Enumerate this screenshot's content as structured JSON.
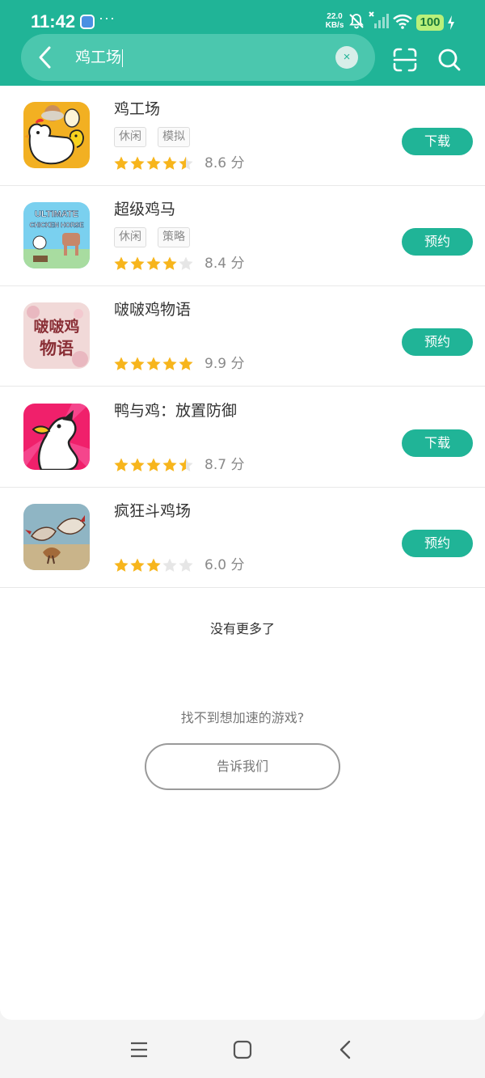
{
  "status_bar": {
    "time": "11:42",
    "dots": "···",
    "net_speed_value": "22.0",
    "net_speed_unit": "KB/s",
    "battery": "100"
  },
  "search": {
    "query": "鸡工场",
    "clear_label": "×"
  },
  "results": [
    {
      "title": "鸡工场",
      "tags": [
        "休闲",
        "模拟"
      ],
      "rating": 4.5,
      "score": "8.6 分",
      "action": "下载"
    },
    {
      "title": "超级鸡马",
      "tags": [
        "休闲",
        "策略"
      ],
      "rating": 4,
      "score": "8.4 分",
      "action": "预约",
      "icon_text": "ULTIMATE CHICKEN HORSE"
    },
    {
      "title": "啵啵鸡物语",
      "tags": [],
      "rating": 5,
      "score": "9.9 分",
      "action": "预约",
      "icon_text": "啵啵鸡 物语"
    },
    {
      "title": "鸭与鸡：放置防御",
      "tags": [],
      "rating": 4.5,
      "score": "8.7 分",
      "action": "下载"
    },
    {
      "title": "疯狂斗鸡场",
      "tags": [],
      "rating": 3,
      "score": "6.0 分",
      "action": "预约"
    }
  ],
  "footer": {
    "no_more": "没有更多了",
    "cant_find": "找不到想加速的游戏?",
    "tell_us": "告诉我们"
  },
  "colors": {
    "brand": "#20b497",
    "star": "#f7b51c",
    "star_empty": "#e6e6e6"
  }
}
